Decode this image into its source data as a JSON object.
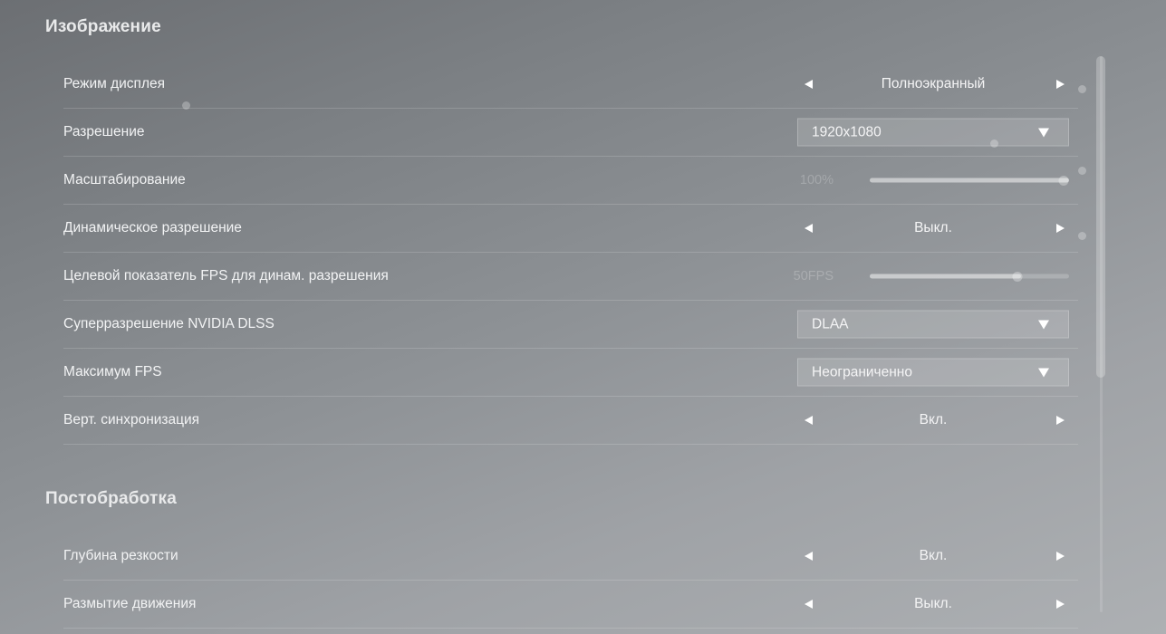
{
  "sections": {
    "image": {
      "title": "Изображение",
      "rows": {
        "display_mode": {
          "label": "Режим дисплея",
          "value": "Полноэкранный"
        },
        "resolution": {
          "label": "Разрешение",
          "value": "1920x1080"
        },
        "scaling": {
          "label": "Масштабирование",
          "value": "100%",
          "level_percent": 100
        },
        "dynamic_resolution": {
          "label": "Динамическое разрешение",
          "value": "Выкл."
        },
        "target_fps": {
          "label": "Целевой показатель FPS для динам. разрешения",
          "value": "50FPS",
          "level_percent": 76
        },
        "dlss": {
          "label": "Суперразрешение NVIDIA DLSS",
          "value": "DLAA"
        },
        "max_fps": {
          "label": "Максимум FPS",
          "value": "Неограниченно"
        },
        "vsync": {
          "label": "Верт. синхронизация",
          "value": "Вкл."
        }
      }
    },
    "postprocessing": {
      "title": "Постобработка",
      "rows": {
        "depth_of_field": {
          "label": "Глубина резкости",
          "value": "Вкл."
        },
        "motion_blur": {
          "label": "Размытие движения",
          "value": "Выкл."
        }
      }
    }
  },
  "icons": {
    "arrow_left": "arrow-left-icon",
    "arrow_right": "arrow-right-icon",
    "dropdown_caret": "chevron-down-icon"
  },
  "colors": {
    "text": "#ffffff",
    "background_start": "#6c6f73",
    "background_end": "#adb0b3"
  }
}
